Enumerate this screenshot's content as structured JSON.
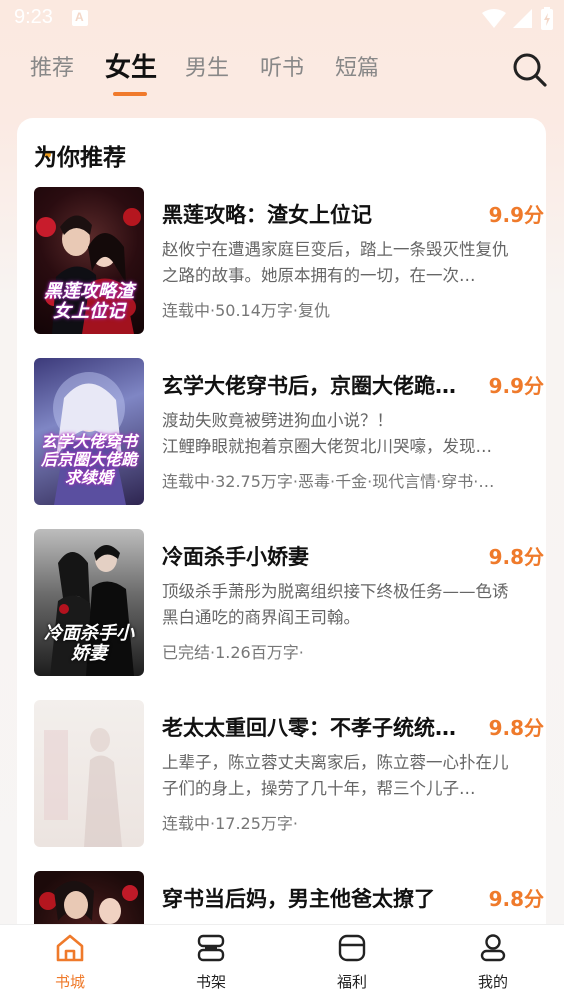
{
  "status_bar": {
    "time": "9:23"
  },
  "tabs": [
    {
      "label": "推荐"
    },
    {
      "label": "女生"
    },
    {
      "label": "男生"
    },
    {
      "label": "听书"
    },
    {
      "label": "短篇"
    }
  ],
  "active_tab": "女生",
  "section": {
    "title": "为你推荐"
  },
  "books": [
    {
      "title": "黑莲攻略：渣女上位记",
      "score": "9.9分",
      "desc": "赵攸宁在遭遇家庭巨变后，踏上一条毁灭性复仇之路的故事。她原本拥有的一切，在一次…",
      "meta": "连载中·50.14万字·复仇",
      "cover_text": "黑莲攻略渣女上位记"
    },
    {
      "title": "玄学大佬穿书后，京圈大佬跪…",
      "score": "9.9分",
      "desc": "渡劫失败竟被劈进狗血小说？！\n江鲤睁眼就抱着京圈大佬贺北川哭嚎，发现…",
      "meta": "连载中·32.75万字·恶毒·千金·现代言情·穿书·…",
      "cover_text": "玄学大佬穿书后京圈大佬跪求续婚"
    },
    {
      "title": "冷面杀手小娇妻",
      "score": "9.8分",
      "desc": "顶级杀手萧彤为脱离组织接下终极任务——色诱黑白通吃的商界阎王司翰。",
      "meta": "已完结·1.26百万字·",
      "cover_text": "冷面杀手小娇妻"
    },
    {
      "title": "老太太重回八零：不孝子统统…",
      "score": "9.8分",
      "desc": "上辈子，陈立蓉丈夫离家后，陈立蓉一心扑在儿子们的身上，操劳了几十年，帮三个儿子…",
      "meta": "连载中·17.25万字·",
      "cover_text": ""
    },
    {
      "title": "穿书当后妈，男主他爸太撩了",
      "score": "9.8分",
      "desc": "",
      "meta": "",
      "cover_text": ""
    }
  ],
  "bottom_nav": [
    {
      "label": "书城",
      "icon": "home-icon"
    },
    {
      "label": "书架",
      "icon": "bookshelf-icon"
    },
    {
      "label": "福利",
      "icon": "gift-icon"
    },
    {
      "label": "我的",
      "icon": "user-icon"
    }
  ],
  "colors": {
    "accent": "#ef7a2b"
  }
}
